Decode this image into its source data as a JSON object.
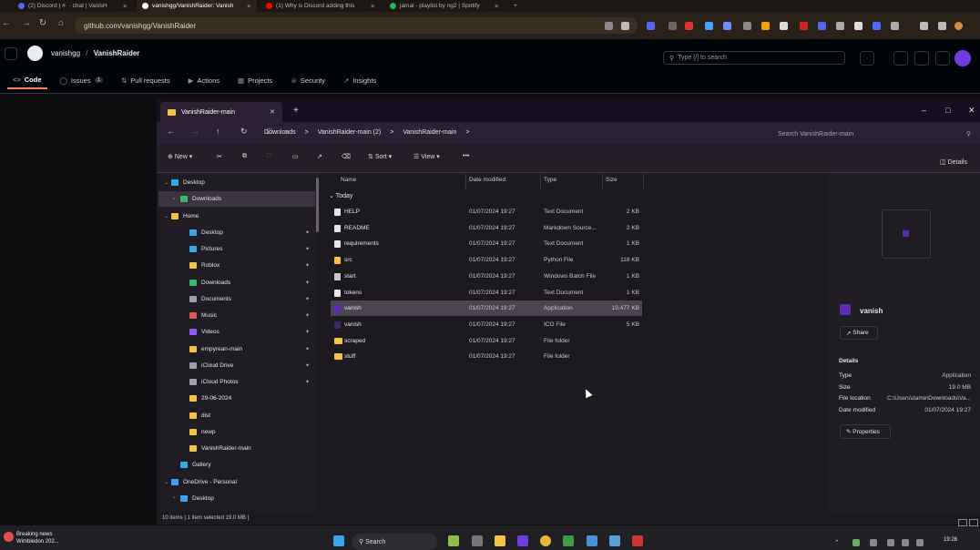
{
  "browser": {
    "tabs": [
      {
        "label": "(2) Discord | #· · chat | VanisH",
        "color": "#5865f2"
      },
      {
        "label": "vanishgg/VanishRaider: Vanish",
        "color": "#ffffff"
      },
      {
        "label": "(1) Why is Discord adding this",
        "color": "#ff0000"
      },
      {
        "label": "jamal - playlist by ng2 | Spotify",
        "color": "#1db954"
      }
    ],
    "new_tab": "+",
    "url": "github.com/vanishgg/VanishRaider"
  },
  "github": {
    "owner": "vanishgg",
    "separator": "/",
    "repo": "VanishRaider",
    "search_placeholder": "Type [/] to search",
    "tabs": [
      {
        "label": "Code",
        "icon": "code-icon"
      },
      {
        "label": "Issues",
        "count": "1",
        "icon": "issue-icon"
      },
      {
        "label": "Pull requests",
        "icon": "pr-icon"
      },
      {
        "label": "Actions",
        "icon": "play-icon"
      },
      {
        "label": "Projects",
        "icon": "table-icon"
      },
      {
        "label": "Security",
        "icon": "shield-icon"
      },
      {
        "label": "Insights",
        "icon": "graph-icon"
      }
    ]
  },
  "explorer": {
    "tab_title": "VanishRaider-main",
    "new_tab": "+",
    "breadcrumbs": [
      "Downloads",
      ">",
      "VanishRaider-main (2)",
      ">",
      "VanishRaider-main",
      ">"
    ],
    "search_placeholder": "Search VanishRaider-main",
    "toolbar": {
      "new": "New",
      "sort": "Sort",
      "view": "View",
      "more": "•••",
      "details": "Details"
    },
    "sidebar": [
      {
        "label": "Desktop",
        "indent": 0,
        "chev": "v",
        "color": "#3fa3e8"
      },
      {
        "label": "Downloads",
        "indent": 1,
        "chev": ">",
        "color": "#3fb56b",
        "sel": true
      },
      {
        "label": "Home",
        "indent": 0,
        "chev": "v",
        "color": "#f4c34b"
      },
      {
        "label": "Desktop",
        "indent": 2,
        "color": "#3fa3e8",
        "pin": true
      },
      {
        "label": "Pictures",
        "indent": 2,
        "color": "#3fa3e8",
        "pin": true
      },
      {
        "label": "Roblox",
        "indent": 2,
        "color": "#f4c34b",
        "pin": true
      },
      {
        "label": "Downloads",
        "indent": 2,
        "color": "#3fb56b",
        "pin": true
      },
      {
        "label": "Documents",
        "indent": 2,
        "color": "#9aa0ad",
        "pin": true
      },
      {
        "label": "Music",
        "indent": 2,
        "color": "#e05a5a",
        "pin": true
      },
      {
        "label": "Videos",
        "indent": 2,
        "color": "#8b5cf6",
        "pin": true
      },
      {
        "label": "empyrean-main",
        "indent": 2,
        "color": "#f4c34b",
        "pin": true
      },
      {
        "label": "iCloud Drive",
        "indent": 2,
        "color": "#9aa0ad",
        "pin": true
      },
      {
        "label": "iCloud Photos",
        "indent": 2,
        "color": "#9aa0ad",
        "pin": true
      },
      {
        "label": "29-06-2024",
        "indent": 2,
        "color": "#f4c34b"
      },
      {
        "label": "dist",
        "indent": 2,
        "color": "#f4c34b"
      },
      {
        "label": "newp",
        "indent": 2,
        "color": "#f4c34b"
      },
      {
        "label": "VanishRaider-main",
        "indent": 2,
        "color": "#f4c34b"
      },
      {
        "label": "Gallery",
        "indent": 1,
        "color": "#3fa3e8"
      },
      {
        "label": "OneDrive - Personal",
        "indent": 0,
        "chev": "v",
        "color": "#3fa3e8"
      },
      {
        "label": "Desktop",
        "indent": 1,
        "chev": ">",
        "color": "#3fa3e8"
      }
    ],
    "columns": {
      "name": "Name",
      "date": "Date modified",
      "type": "Type",
      "size": "Size"
    },
    "group": "Today",
    "files": [
      {
        "name": "HELP",
        "date": "01/07/2024 19:27",
        "type": "Text Document",
        "size": "2 KB",
        "color": "#e6e6e6"
      },
      {
        "name": "README",
        "date": "01/07/2024 19:27",
        "type": "Markdown Source...",
        "size": "2 KB",
        "color": "#e6e6e6"
      },
      {
        "name": "requirements",
        "date": "01/07/2024 19:27",
        "type": "Text Document",
        "size": "1 KB",
        "color": "#e6e6e6"
      },
      {
        "name": "src",
        "date": "01/07/2024 19:27",
        "type": "Python File",
        "size": "118 KB",
        "color": "#f4c34b"
      },
      {
        "name": "start",
        "date": "01/07/2024 19:27",
        "type": "Windows Batch File",
        "size": "1 KB",
        "color": "#c9c9c9"
      },
      {
        "name": "tokens",
        "date": "01/07/2024 19:27",
        "type": "Text Document",
        "size": "1 KB",
        "color": "#e6e6e6"
      },
      {
        "name": "vanish",
        "date": "01/07/2024 19:27",
        "type": "Application",
        "size": "19,477 KB",
        "color": "#5b2bb5",
        "sel": true
      },
      {
        "name": "vanish",
        "date": "01/07/2024 19:27",
        "type": "ICO File",
        "size": "5 KB",
        "color": "#3b2a6b"
      },
      {
        "name": "scraped",
        "date": "01/07/2024 19:27",
        "type": "File folder",
        "size": "",
        "color": "#f4c34b"
      },
      {
        "name": "stuff",
        "date": "01/07/2024 19:27",
        "type": "File folder",
        "size": "",
        "color": "#f4c34b"
      }
    ],
    "details": {
      "name": "vanish",
      "share": "Share",
      "heading": "Details",
      "props": [
        {
          "k": "Type",
          "v": "Application"
        },
        {
          "k": "Size",
          "v": "19.0 MB"
        },
        {
          "k": "File location",
          "v": "C:\\Users\\dame\\Downloads\\Va..."
        },
        {
          "k": "Date modified",
          "v": "01/07/2024 19:27"
        }
      ],
      "properties": "Properties"
    },
    "status": "10 items  |  1 item selected  19.0 MB  |"
  },
  "taskbar": {
    "news_title": "Breaking news",
    "news_sub": "Wimbledon 202...",
    "search": "Search",
    "time": "19:28"
  }
}
